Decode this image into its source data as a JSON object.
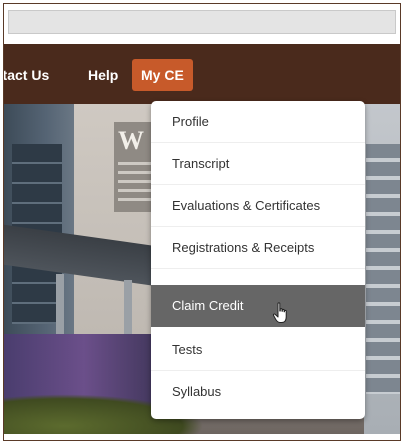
{
  "nav": {
    "contact_label": "ntact Us",
    "help_label": "Help",
    "myce_label": "My CE"
  },
  "hero": {
    "sign_letter": "W"
  },
  "menu": {
    "items": [
      {
        "label": "Profile"
      },
      {
        "label": "Transcript"
      },
      {
        "label": "Evaluations & Certificates"
      },
      {
        "label": "Registrations & Receipts"
      },
      {
        "label": "Claim Credit"
      },
      {
        "label": "Tests"
      },
      {
        "label": "Syllabus"
      }
    ],
    "active_index": 4
  },
  "colors": {
    "navbar": "#4a2a1c",
    "myce_accent": "#c75a2a",
    "menu_active": "#666666"
  },
  "icons": {
    "cursor": "hand-pointer-icon"
  }
}
